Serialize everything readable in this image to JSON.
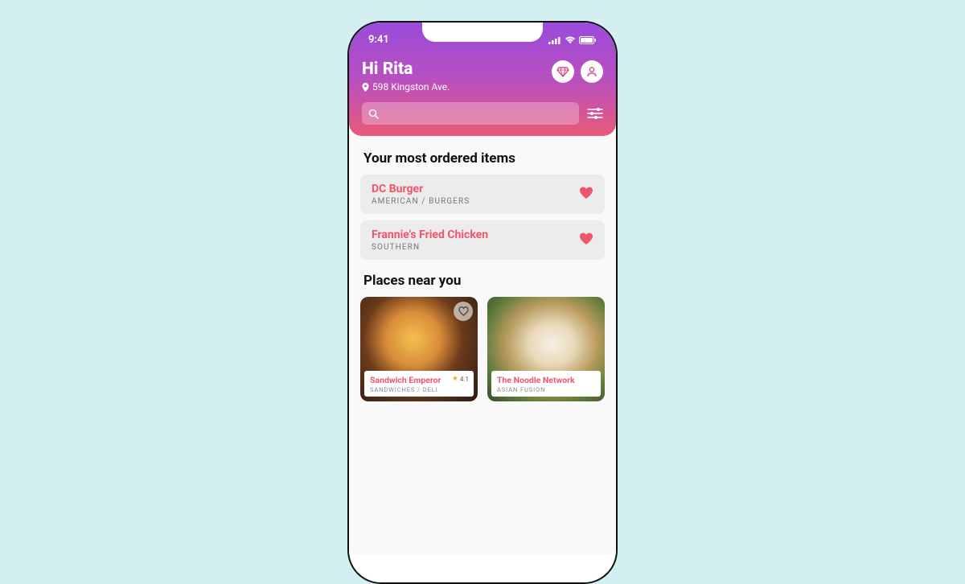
{
  "statusbar": {
    "time": "9:41"
  },
  "header": {
    "greeting": "Hi Rita",
    "address": "598 Kingston Ave."
  },
  "sections": {
    "most_ordered_title": "Your most ordered items",
    "places_title": "Places near you"
  },
  "most_ordered": [
    {
      "name": "DC Burger",
      "category": "AMERICAN / BURGERS"
    },
    {
      "name": "Frannie's Fried Chicken",
      "category": "SOUTHERN"
    }
  ],
  "places": [
    {
      "name": "Sandwich Emperor",
      "category": "SANDWICHES / DELI",
      "rating": "4.1"
    },
    {
      "name": "The Noodle Network",
      "category": "ASIAN FUSION"
    }
  ]
}
